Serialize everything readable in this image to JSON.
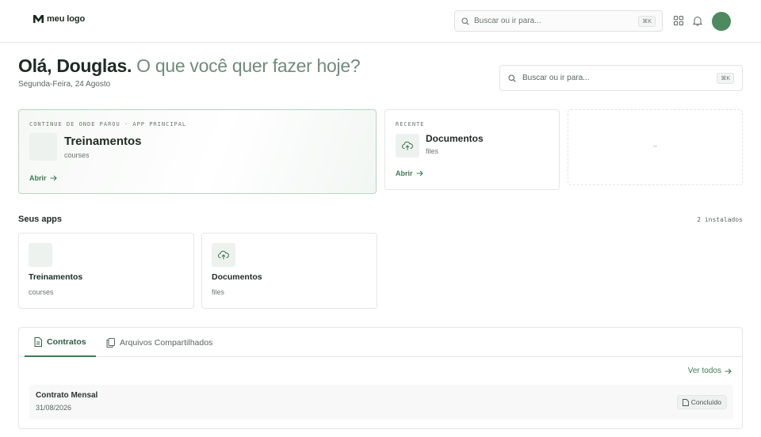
{
  "brand": {
    "logo_text": "meu logo"
  },
  "topbar": {
    "search_placeholder": "Buscar ou ir para...",
    "search_shortcut": "⌘K",
    "icons": [
      "grid-icon",
      "bell-icon"
    ]
  },
  "greeting": {
    "hello": "Olá, Douglas.",
    "question": "O que você quer fazer hoje?",
    "date": "Segunda-Feira, 24 Agosto"
  },
  "main_search": {
    "placeholder": "Buscar ou ir para...",
    "shortcut": "⌘K"
  },
  "continue_card": {
    "eyebrow": "CONTINUE DE ONDE PAROU · APP PRINCIPAL",
    "title": "Treinamentos",
    "slug": "courses",
    "open_label": "Abrir"
  },
  "recent_card": {
    "eyebrow": "RECENTE",
    "title": "Documentos",
    "slug": "files",
    "open_label": "Abrir"
  },
  "placeholder_card": {
    "text": "–"
  },
  "apps": {
    "title": "Seus apps",
    "installed_label": "2 instalados",
    "items": [
      {
        "title": "Treinamentos",
        "slug": "courses"
      },
      {
        "title": "Documentos",
        "slug": "files"
      }
    ]
  },
  "panel": {
    "tabs": [
      {
        "label": "Contratos",
        "active": true
      },
      {
        "label": "Arquivos Compartilhados",
        "active": false
      }
    ],
    "see_all_label": "Ver todos",
    "rows": [
      {
        "name": "Contrato Mensal",
        "date": "31/08/2026",
        "status": "Concluído"
      }
    ]
  },
  "colors": {
    "accent": "#3f7a52",
    "avatar": "#4e8a60",
    "muted_heading": "#708b7c"
  }
}
